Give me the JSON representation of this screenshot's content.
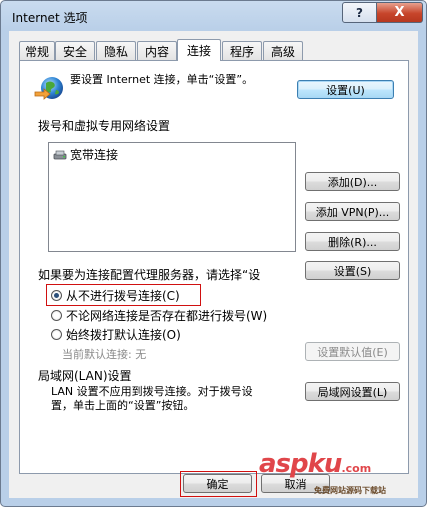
{
  "window": {
    "title": "Internet 选项",
    "help_label": "?",
    "close_label": "X"
  },
  "tabs": [
    {
      "label": "常规",
      "active": false
    },
    {
      "label": "安全",
      "active": false
    },
    {
      "label": "隐私",
      "active": false
    },
    {
      "label": "内容",
      "active": false
    },
    {
      "label": "连接",
      "active": true
    },
    {
      "label": "程序",
      "active": false
    },
    {
      "label": "高级",
      "active": false
    }
  ],
  "connections": {
    "setup_text": "要设置 Internet 连接，单击“设置”。",
    "setup_button": "设置(U)",
    "dialup_heading": "拨号和虚拟专用网络设置",
    "list_items": [
      "宽带连接"
    ],
    "add_button": "添加(D)...",
    "add_vpn_button": "添加 VPN(P)...",
    "remove_button": "删除(R)...",
    "proxy_text": "如果要为连接配置代理服务器，请选择“设",
    "settings_button": "设置(S)",
    "radio_options": [
      {
        "label": "从不进行拨号连接(C)",
        "checked": true
      },
      {
        "label": "不论网络连接是否存在都进行拨号(W)",
        "checked": false
      },
      {
        "label": "始终拨打默认连接(O)",
        "checked": false
      }
    ],
    "current_default_label": "当前默认连接: 无",
    "set_default_button": "设置默认值(E)",
    "lan_heading": "局域网(LAN)设置",
    "lan_text_line1": "LAN 设置不应用到拨号连接。对于拨号设",
    "lan_text_line2": "置，单击上面的“设置”按钮。",
    "lan_button": "局域网设置(L)"
  },
  "footer": {
    "ok_button": "确定",
    "cancel_button": "取消"
  },
  "watermark": {
    "main": "aspku",
    "tld": ".com",
    "tagline": "免费网站源码下载站"
  }
}
